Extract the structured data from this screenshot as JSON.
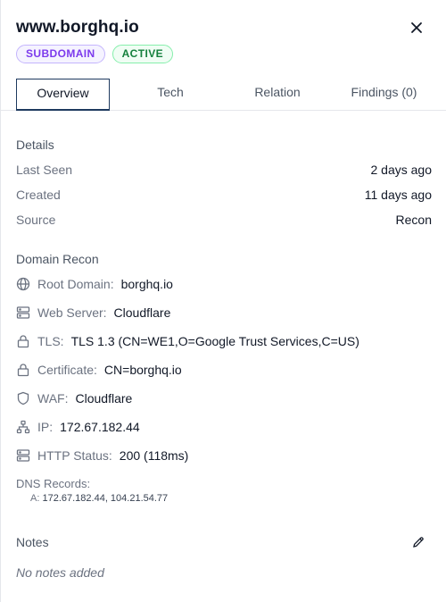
{
  "header": {
    "title": "www.borghq.io",
    "badges": {
      "type": "SUBDOMAIN",
      "status": "ACTIVE"
    }
  },
  "tabs": [
    {
      "label": "Overview",
      "active": true
    },
    {
      "label": "Tech"
    },
    {
      "label": "Relation"
    },
    {
      "label": "Findings (0)"
    }
  ],
  "details": {
    "title": "Details",
    "rows": [
      {
        "label": "Last Seen",
        "value": "2 days ago"
      },
      {
        "label": "Created",
        "value": "11 days ago"
      },
      {
        "label": "Source",
        "value": "Recon"
      }
    ]
  },
  "recon": {
    "title": "Domain Recon",
    "items": [
      {
        "icon": "globe-icon",
        "label": "Root Domain:",
        "value": "borghq.io"
      },
      {
        "icon": "server-icon",
        "label": "Web Server:",
        "value": "Cloudflare"
      },
      {
        "icon": "lock-icon",
        "label": "TLS:",
        "value": "TLS 1.3 (CN=WE1,O=Google Trust Services,C=US)"
      },
      {
        "icon": "lock-icon",
        "label": "Certificate:",
        "value": "CN=borghq.io"
      },
      {
        "icon": "shield-icon",
        "label": "WAF:",
        "value": "Cloudflare"
      },
      {
        "icon": "network-icon",
        "label": "IP:",
        "value": "172.67.182.44"
      },
      {
        "icon": "server-icon",
        "label": "HTTP Status:",
        "value": "200 (118ms)"
      }
    ],
    "dns": {
      "label": "DNS Records:",
      "records": [
        {
          "type": "A:",
          "value": "172.67.182.44, 104.21.54.77"
        }
      ]
    }
  },
  "notes": {
    "title": "Notes",
    "empty": "No notes added"
  }
}
